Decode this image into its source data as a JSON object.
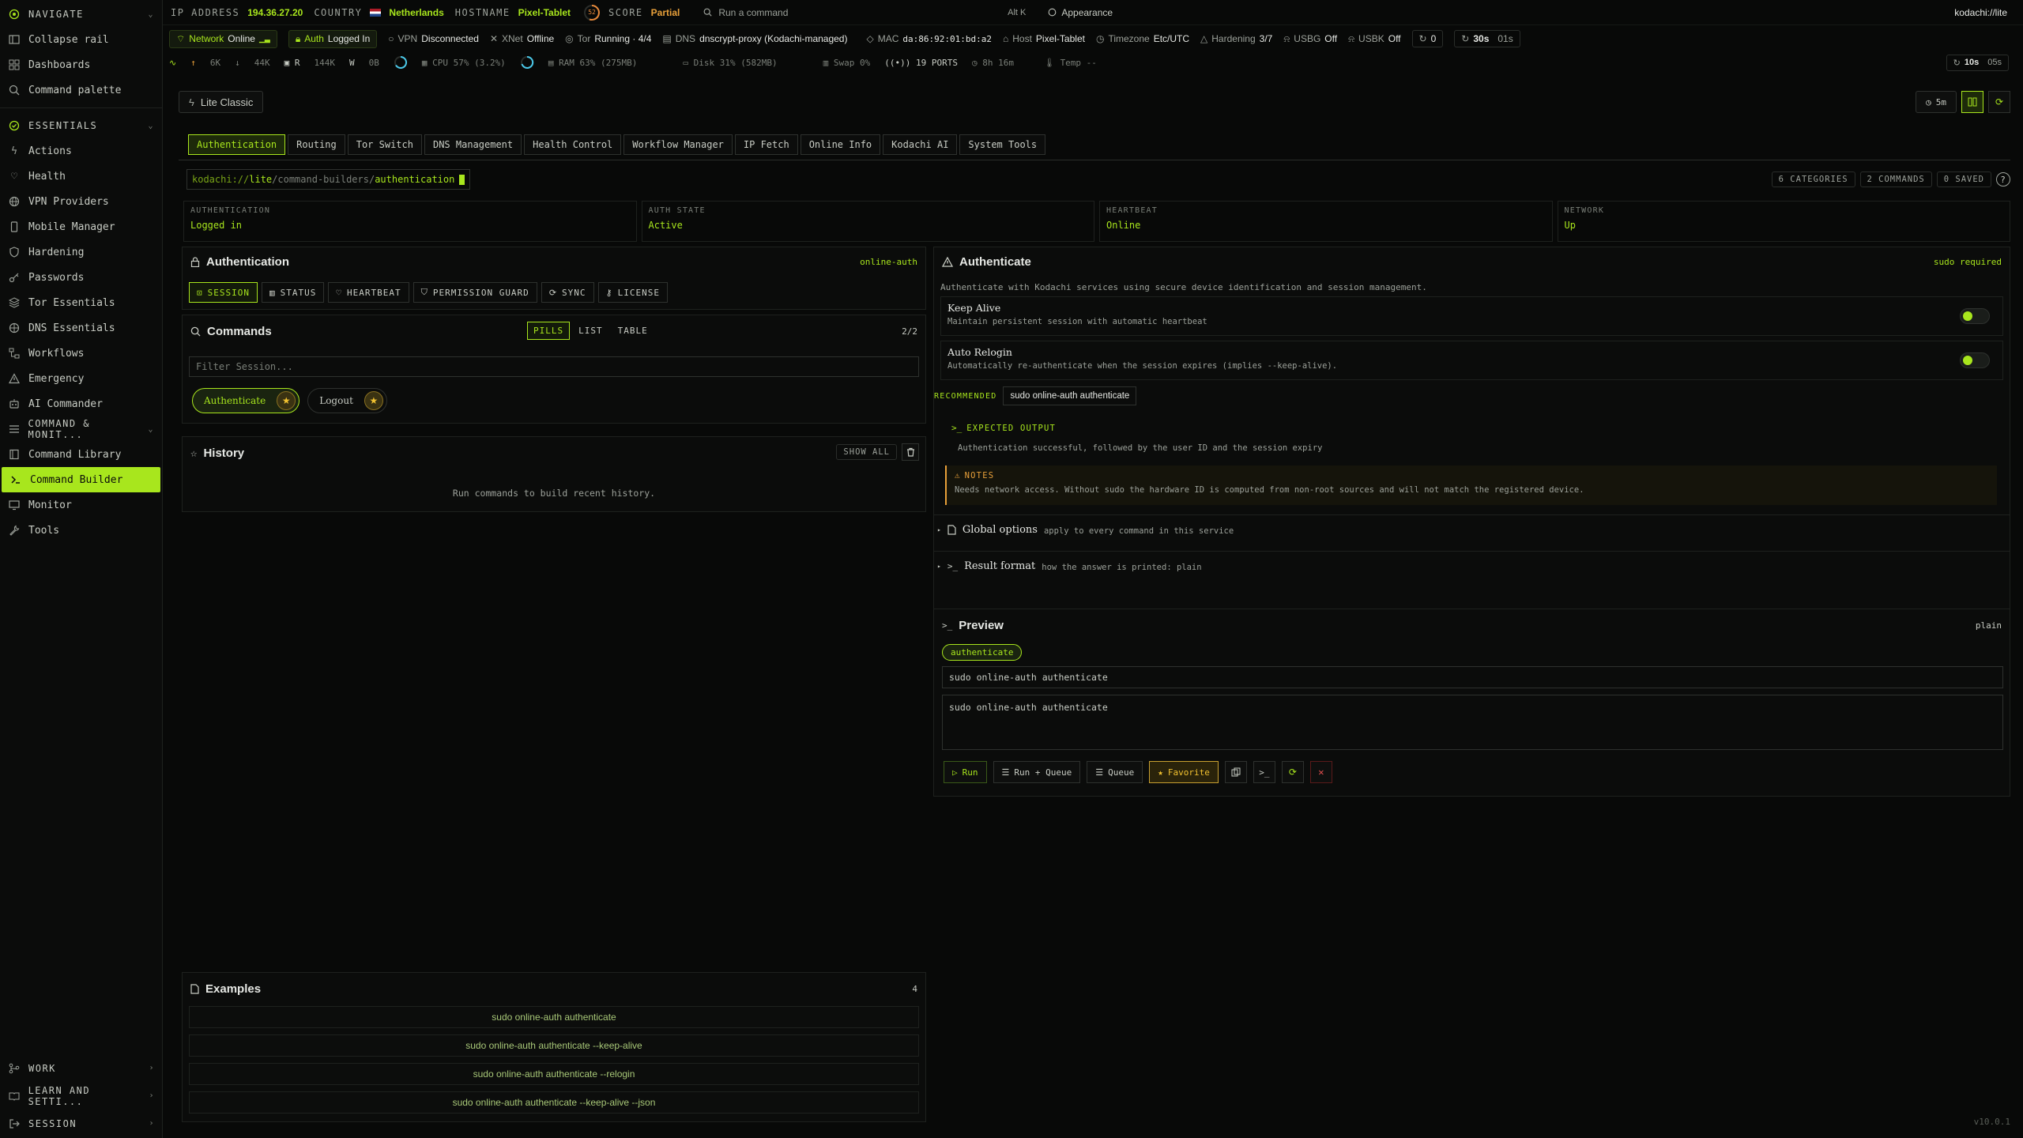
{
  "sidebar": {
    "navigate_label": "NAVIGATE",
    "nav_items": [
      {
        "label": "Collapse rail"
      },
      {
        "label": "Dashboards"
      },
      {
        "label": "Command palette"
      }
    ],
    "essentials_label": "ESSENTIALS",
    "essentials_items": [
      {
        "label": "Actions"
      },
      {
        "label": "Health"
      },
      {
        "label": "VPN Providers"
      },
      {
        "label": "Mobile Manager"
      },
      {
        "label": "Hardening"
      },
      {
        "label": "Passwords"
      },
      {
        "label": "Tor Essentials"
      },
      {
        "label": "DNS Essentials"
      },
      {
        "label": "Workflows"
      },
      {
        "label": "Emergency"
      },
      {
        "label": "AI Commander"
      }
    ],
    "command_label": "COMMAND & MONIT...",
    "command_items": [
      {
        "label": "Command Library"
      },
      {
        "label": "Command Builder"
      },
      {
        "label": "Monitor"
      },
      {
        "label": "Tools"
      }
    ],
    "work_label": "WORK",
    "learn_label": "LEARN AND SETTI...",
    "session_label": "SESSION"
  },
  "topbar": {
    "ip_label": "IP ADDRESS",
    "ip_value": "194.36.27.20",
    "country_label": "COUNTRY",
    "country_value": "Netherlands",
    "hostname_label": "HOSTNAME",
    "hostname_value": "Pixel-Tablet",
    "score_number": "52",
    "score_label": "SCORE",
    "score_value": "Partial",
    "search_placeholder": "Run a command",
    "search_shortcut": "Alt K",
    "appearance_label": "Appearance",
    "brand": "kodachi://lite"
  },
  "statusbar": {
    "network_label": "Network",
    "network_value": "Online",
    "auth_label": "Auth",
    "auth_value": "Logged In",
    "vpn_label": "VPN",
    "vpn_value": "Disconnected",
    "xnet_label": "XNet",
    "xnet_value": "Offline",
    "tor_label": "Tor",
    "tor_value": "Running · 4/4",
    "dns_label": "DNS",
    "dns_value": "dnscrypt-proxy (Kodachi-managed)",
    "mac_label": "MAC",
    "mac_value": "da:86:92:01:bd:a2",
    "host_label": "Host",
    "host_value": "Pixel-Tablet",
    "tz_label": "Timezone",
    "tz_value": "Etc/UTC",
    "hardening_label": "Hardening",
    "hardening_value": "3/7",
    "usbg_label": "USBG",
    "usbg_value": "Off",
    "usbk_label": "USBK",
    "usbk_value": "Off",
    "alerts_count": "0",
    "refresh_a": "30s",
    "refresh_b": "01s"
  },
  "metrics": {
    "up": "6K",
    "down": "44K",
    "read": "R",
    "read_val": "144K",
    "write": "W",
    "write_val": "0B",
    "cpu": "CPU 57% (3.2%)",
    "ram": "RAM 63% (275MB)",
    "disk": "Disk 31% (582MB)",
    "swap": "Swap 0%",
    "ports": "19 PORTS",
    "uptime": "8h 16m",
    "temp": "Temp --",
    "refresh_a": "10s",
    "refresh_b": "05s"
  },
  "main": {
    "theme_button": "Lite Classic",
    "timer_label": "5m",
    "tabs": [
      "Authentication",
      "Routing",
      "Tor Switch",
      "DNS Management",
      "Health Control",
      "Workflow Manager",
      "IP Fetch",
      "Online Info",
      "Kodachi AI",
      "System Tools"
    ],
    "path_prefix": "kodachi://",
    "path_lite": "lite",
    "path_mid": "/command-builders/",
    "path_end": "authentication",
    "categories": "6 CATEGORIES",
    "commands": "2 COMMANDS",
    "saved": "0 SAVED",
    "stats": [
      {
        "label": "AUTHENTICATION",
        "value": "Logged in"
      },
      {
        "label": "AUTH STATE",
        "value": "Active"
      },
      {
        "label": "HEARTBEAT",
        "value": "Online"
      },
      {
        "label": "NETWORK",
        "value": "Up"
      }
    ]
  },
  "auth_panel": {
    "title": "Authentication",
    "tag": "online-auth",
    "subtabs": [
      "SESSION",
      "STATUS",
      "HEARTBEAT",
      "PERMISSION GUARD",
      "SYNC",
      "LICENSE"
    ]
  },
  "commands_panel": {
    "title": "Commands",
    "views": [
      "PILLS",
      "LIST",
      "TABLE"
    ],
    "count": "2/2",
    "filter_placeholder": "Filter Session...",
    "items": [
      "Authenticate",
      "Logout"
    ]
  },
  "history_panel": {
    "title": "History",
    "show_all": "SHOW ALL",
    "empty": "Run commands to build recent history."
  },
  "examples_panel": {
    "title": "Examples",
    "count": "4",
    "items": [
      "sudo online-auth authenticate",
      "sudo online-auth authenticate --keep-alive",
      "sudo online-auth authenticate --relogin",
      "sudo online-auth authenticate --keep-alive --json"
    ]
  },
  "detail_panel": {
    "title": "Authenticate",
    "sudo": "sudo required",
    "description": "Authenticate with Kodachi services using secure device identification and session management.",
    "options": [
      {
        "name": "Keep Alive",
        "desc": "Maintain persistent session with automatic heartbeat"
      },
      {
        "name": "Auto Relogin",
        "desc": "Automatically re-authenticate when the session expires (implies --keep-alive)."
      }
    ],
    "recommended_label": "RECOMMENDED",
    "recommended_cmd": "sudo online-auth authenticate",
    "expected_label": "EXPECTED OUTPUT",
    "expected_text": "Authentication successful, followed by the user ID and the session expiry",
    "notes_label": "NOTES",
    "notes_text": "Needs network access. Without sudo the hardware ID is computed from non-root sources and will not match the registered device.",
    "global_title": "Global options",
    "global_desc": "apply to every command in this service",
    "result_title": "Result format",
    "result_desc": "how the answer is printed: plain"
  },
  "preview_panel": {
    "title": "Preview",
    "format": "plain",
    "chip": "authenticate",
    "command": "sudo online-auth authenticate",
    "textarea": "sudo online-auth authenticate",
    "buttons": [
      "Run",
      "Run + Queue",
      "Queue",
      "Favorite"
    ]
  },
  "version": "v10.0.1"
}
